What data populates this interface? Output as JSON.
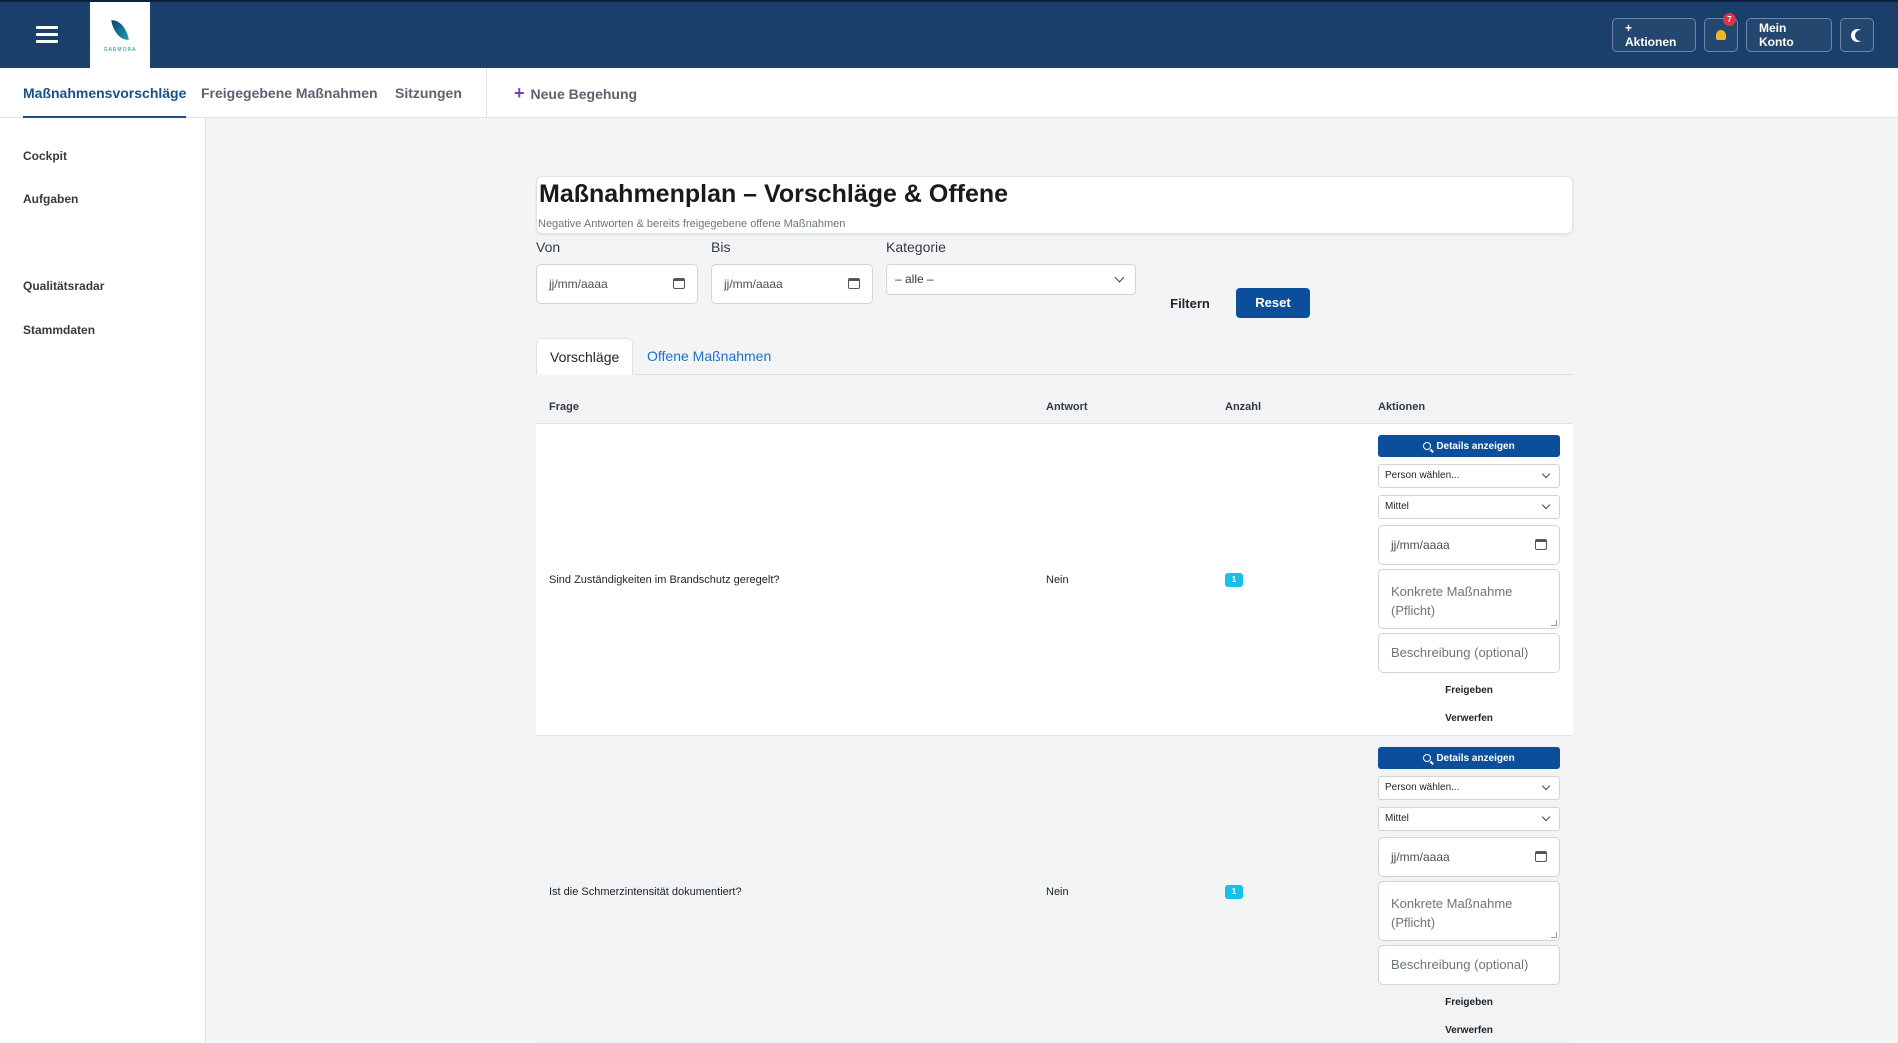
{
  "topbar": {
    "logo_text": "GARMORA",
    "actions_label": "+ Aktionen",
    "notifications_count": "7",
    "account_label": "Mein Konto"
  },
  "subnav": {
    "items": [
      "Maßnahmensvorschläge",
      "Freigegebene Maßnahmen",
      "Sitzungen"
    ],
    "new_label": "Neue Begehung"
  },
  "sidebar": {
    "items": [
      "Cockpit",
      "Aufgaben",
      "Qualitätsradar",
      "Stammdaten"
    ]
  },
  "header": {
    "title": "Maßnahmenplan – Vorschläge & Offene",
    "subtitle": "Negative Antworten & bereits freigegebene offene Maßnahmen"
  },
  "filters": {
    "von_label": "Von",
    "von_value": "jj/mm/aaaa",
    "bis_label": "Bis",
    "bis_value": "jj/mm/aaaa",
    "kategorie_label": "Kategorie",
    "kategorie_value": "– alle –",
    "filter_label": "Filtern",
    "reset_label": "Reset"
  },
  "tabs": [
    "Vorschläge",
    "Offene Maßnahmen"
  ],
  "table": {
    "columns": [
      "Frage",
      "Antwort",
      "Anzahl",
      "Aktionen"
    ],
    "rows": [
      {
        "frage": "Sind Zuständigkeiten im Brandschutz geregelt?",
        "antwort": "Nein",
        "anzahl": "1"
      },
      {
        "frage": "Ist die Schmerzintensität dokumentiert?",
        "antwort": "Nein",
        "anzahl": "1"
      }
    ],
    "actions": {
      "details_label": "Details anzeigen",
      "person_value": "Person wählen...",
      "priority_value": "Mittel",
      "date_value": "jj/mm/aaaa",
      "massnahme_placeholder": "Konkrete Maßnahme (Pflicht)",
      "beschreibung_placeholder": "Beschreibung (optional)",
      "freigeben_label": "Freigeben",
      "verwerfen_label": "Verwerfen"
    }
  }
}
